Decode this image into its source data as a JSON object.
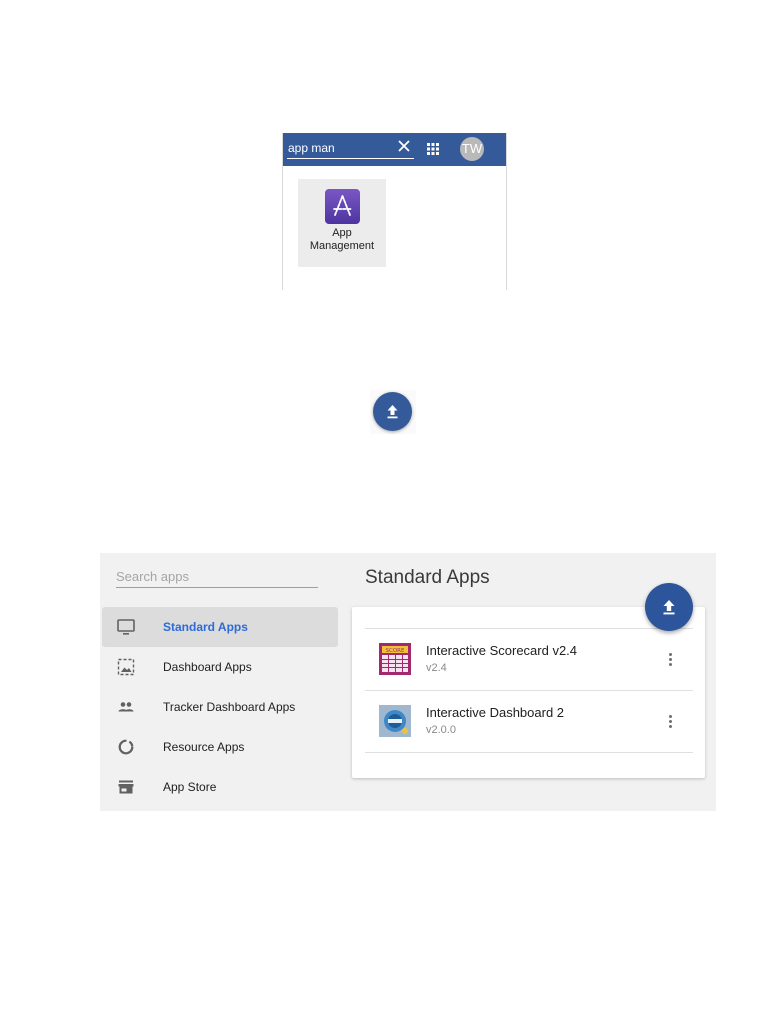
{
  "search_popup": {
    "query": "app man",
    "avatar_initials": "TW",
    "result": {
      "label": "App\nManagement",
      "icon": "app-store-icon"
    },
    "colors": {
      "header": "#345a9a",
      "tile": "#ececec",
      "icon": "#5e3fb0"
    }
  },
  "upload_fab": {
    "icon": "upload-icon",
    "color": "#345a9a"
  },
  "app_management": {
    "search_placeholder": "Search apps",
    "page_title": "Standard Apps",
    "accent_color": "#2f6bd6",
    "nav": [
      {
        "label": "Standard Apps",
        "icon": "monitor-icon",
        "active": true
      },
      {
        "label": "Dashboard Apps",
        "icon": "dashboard-image-icon",
        "active": false
      },
      {
        "label": "Tracker Dashboard Apps",
        "icon": "people-icon",
        "active": false
      },
      {
        "label": "Resource Apps",
        "icon": "donut-icon",
        "active": false
      },
      {
        "label": "App Store",
        "icon": "store-icon",
        "active": false
      }
    ],
    "apps": [
      {
        "name": "Interactive Scorecard v2.4",
        "version": "v2.4",
        "icon": "scorecard-icon"
      },
      {
        "name": "Interactive Dashboard 2",
        "version": "v2.0.0",
        "icon": "dashboard-thumb-icon"
      }
    ],
    "upload_icon": "upload-icon"
  }
}
